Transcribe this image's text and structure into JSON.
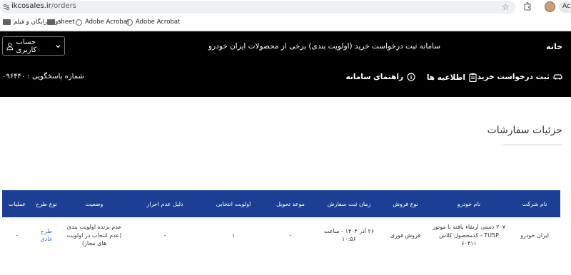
{
  "browser": {
    "url_host": "ikcosales.ir",
    "url_path": "/orders",
    "profile_chip": "Ac",
    "bookmarks": [
      {
        "label": "دوره رایگان و فیلم",
        "icon": "folder-icon"
      },
      {
        "label": "sheet",
        "icon": "folder-icon"
      },
      {
        "label": "Adobe Acrobat",
        "icon": "globe-icon"
      },
      {
        "label": "Adobe Acrobat",
        "icon": "globe-icon"
      }
    ]
  },
  "header": {
    "home": "خانه",
    "title": "سامانه ثبت درخواست خرید (اولویت بندی) برخی از محصولات ایران خودرو",
    "user_button": "حساب کاربری",
    "nav": {
      "register": "ثبت درخواست خرید",
      "announcements": "اطلاعیه ها",
      "guide": "راهنمای سامانه"
    },
    "support": "شماره پاسخگویی : ۰۹۶۴۴۰"
  },
  "main": {
    "heading": "جزئیات سفارشات"
  },
  "table": {
    "columns": [
      "نام شرکت",
      "نام خودرو",
      "نوع فروش",
      "زمان ثبت سفارش",
      "موعد تحویل",
      "اولویت انتخابی",
      "دلیل عدم احراز",
      "وضعیت",
      "نوع طرح",
      "عملیات"
    ],
    "rows": [
      [
        "ایران خودرو",
        "۲۰۷ دستی ارتقاء یافته با موتور TU5P - کدمحصول کلاس ۶۰۴۱۱",
        "فروش فوری",
        "۲۶ آذر ۱۴۰۴ - ساعت ۱۰:۵۶",
        "-",
        "۱",
        "-",
        "عدم برنده اولویت بندی (عدم انتخاب در اولویت های مجاز)",
        "طرح عادی",
        "-"
      ]
    ]
  }
}
